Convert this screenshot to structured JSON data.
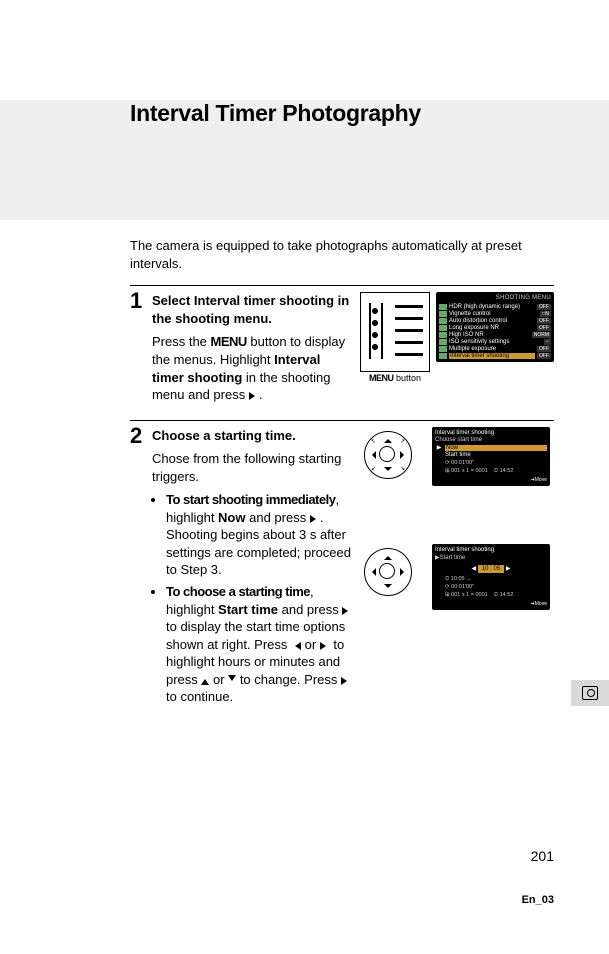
{
  "title": "Interval Timer Photography",
  "intro": "The camera is equipped to take photographs automatically at preset intervals.",
  "step1": {
    "num": "1",
    "heading_pre": "Select ",
    "heading_b": "Interval timer shooting",
    "heading_post": " in the shooting menu.",
    "para_1": "Press the ",
    "para_menu": "MENU",
    "para_2": " button to display the menus. Highlight ",
    "para_b": "Interval timer shooting",
    "para_3": " in the shooting menu and press ",
    "fig_label_menu": "MENU",
    "fig_label_btn": "button",
    "lcd_title": "SHOOTING MENU",
    "lcd_rows": [
      {
        "label": "HDR (high dynamic range)",
        "val": "OFF"
      },
      {
        "label": "Vignette control",
        "val": "□N"
      },
      {
        "label": "Auto distortion control",
        "val": "OFF"
      },
      {
        "label": "Long exposure NR",
        "val": "OFF"
      },
      {
        "label": "High ISO NR",
        "val": "NORM"
      },
      {
        "label": "ISO sensitivity settings",
        "val": "--"
      },
      {
        "label": "Multiple exposure",
        "val": "OFF"
      },
      {
        "label": "Interval timer shooting",
        "val": "OFF"
      }
    ]
  },
  "step2": {
    "num": "2",
    "heading": "Choose a starting time.",
    "intro": "Chose from the following starting triggers.",
    "bullet1_hd": "To start shooting immediately",
    "bullet1_a": ", highlight ",
    "bullet1_now": "Now",
    "bullet1_b": " and press ",
    "bullet1_c": ". Shooting begins about 3 s after settings are completed; proceed to Step 3.",
    "bullet2_hd": "To choose a starting time",
    "bullet2_a": ", highlight ",
    "bullet2_st": "Start time",
    "bullet2_b": " and press ",
    "bullet2_c": " to display the start time options shown at right. Press ",
    "bullet2_d": " or ",
    "bullet2_e": " to highlight hours or minutes and press ",
    "bullet2_f": " or ",
    "bullet2_g": " to change.  Press ",
    "bullet2_h": " to continue.",
    "lcd1": {
      "title": "Interval timer shooting",
      "sub": "Choose start time",
      "row_now": "Now",
      "row_start": "Start time",
      "info1": "00:01'00\"",
      "info2": "001 x 1 = 0001",
      "clock": "14:52",
      "foot": "➔Move"
    },
    "lcd2": {
      "title": "Interval timer shooting",
      "sub": "▶Start time",
      "time": "10 : 05",
      "info0": "10:05 →",
      "info1": "00:01'00\"",
      "info2": "001 x 1 = 0001",
      "clock": "14:52",
      "foot": "➔Move"
    }
  },
  "page_number": "201",
  "footer_code": "En_03"
}
